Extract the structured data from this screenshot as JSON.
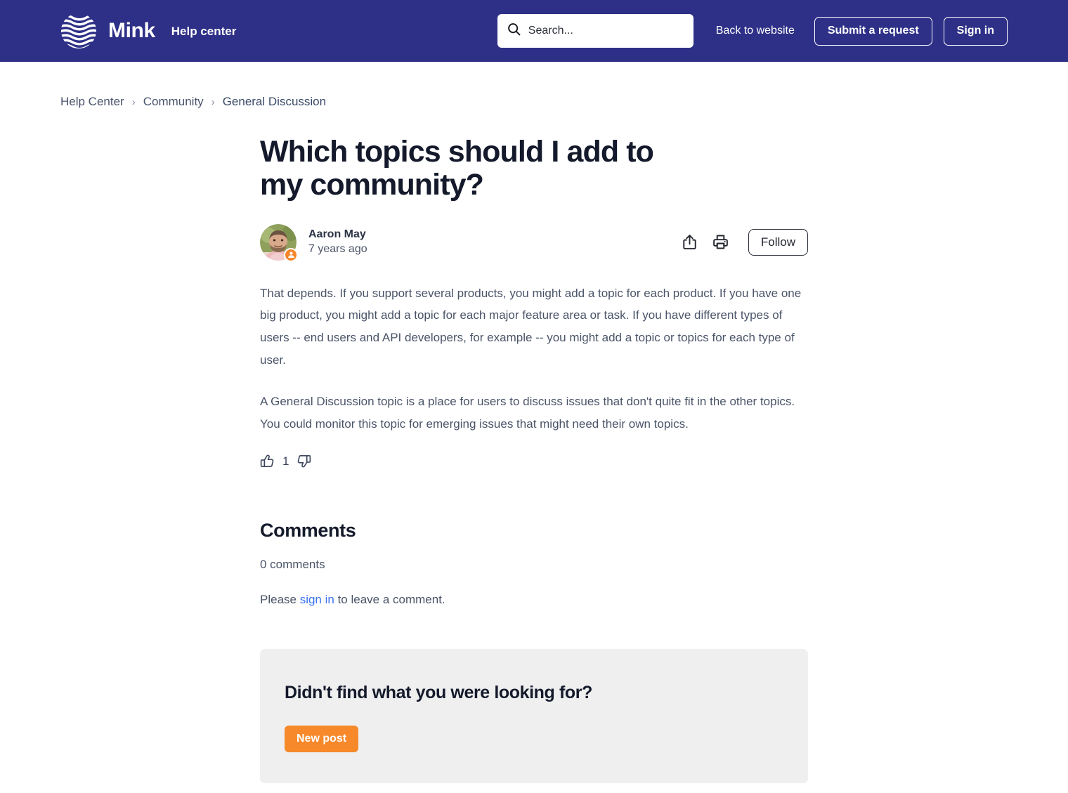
{
  "header": {
    "brand_name": "Mink",
    "brand_sub": "Help center",
    "logo_icon": "globe-waves-icon",
    "background_color": "#2e3087",
    "search": {
      "placeholder": "Search...",
      "value": "",
      "icon": "search-icon"
    },
    "back_to_website": "Back to website",
    "submit_request": "Submit a request",
    "sign_in": "Sign in"
  },
  "breadcrumb": {
    "items": [
      {
        "label": "Help Center"
      },
      {
        "label": "Community"
      },
      {
        "label": "General Discussion"
      }
    ],
    "separator": "›"
  },
  "article": {
    "title": "Which topics should I add to my community?",
    "author": {
      "name": "Aaron May",
      "date": "7 years ago",
      "avatar_icon": "user-photo-avatar",
      "badge_icon": "user-badge-icon",
      "badge_color": "#f6862a"
    },
    "actions": {
      "share_icon": "share-icon",
      "print_icon": "print-icon",
      "follow_label": "Follow"
    },
    "paragraphs": [
      "That depends. If you support several products, you might add a topic for each product. If you have one big product, you might add a topic for each major feature area or task. If you have different types of users -- end users and API developers, for example -- you might add a topic or topics for each type of user.",
      "A General Discussion topic is a place for users to discuss issues that don't quite fit in the other topics. You could monitor this topic for emerging issues that might need their own topics."
    ],
    "votes": {
      "up_icon": "thumbs-up-icon",
      "down_icon": "thumbs-down-icon",
      "count": "1"
    }
  },
  "comments": {
    "heading": "Comments",
    "count_label": "0 comments",
    "signin_prefix": "Please ",
    "signin_link": "sign in",
    "signin_suffix": " to leave a comment."
  },
  "callout": {
    "title": "Didn't find what you were looking for?",
    "button_label": "New post",
    "button_color": "#f7892b",
    "background_color": "#efefef"
  }
}
